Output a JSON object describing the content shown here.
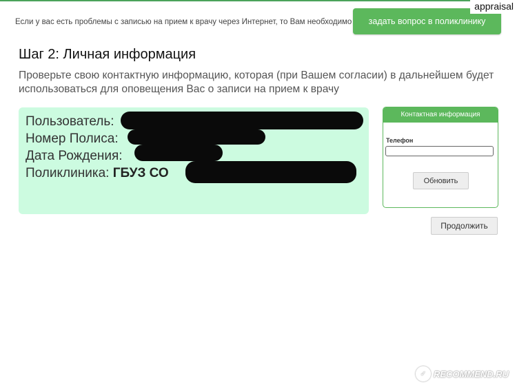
{
  "header": {
    "notice": "Если у вас есть проблемы с записью на прием к врачу через Интернет, то Вам необходимо",
    "ask_button": "задать вопрос в поликлинику",
    "corner_tag": "appraisal"
  },
  "step": {
    "title": "Шаг 2: Личная информация",
    "description": "Проверьте свою контактную информацию, которая (при Вашем согласии) в дальнейшем будет использоваться для оповещения Вас о записи на прием к врачу"
  },
  "personal_info": {
    "user_label": "Пользователь:",
    "policy_label": "Номер Полиса:",
    "birth_label": "Дата Рождения:",
    "clinic_label": "Поликлиника:",
    "clinic_value": "ГБУЗ СО"
  },
  "contact_panel": {
    "title": "Контактная информация",
    "phone_label": "Телефон",
    "phone_value": "",
    "refresh_button": "Обновить"
  },
  "actions": {
    "continue_button": "Продолжить"
  },
  "watermark": {
    "text": "RECOMMEND.RU"
  },
  "colors": {
    "accent_green": "#5cb85c",
    "info_bg": "#ccfbe0"
  }
}
